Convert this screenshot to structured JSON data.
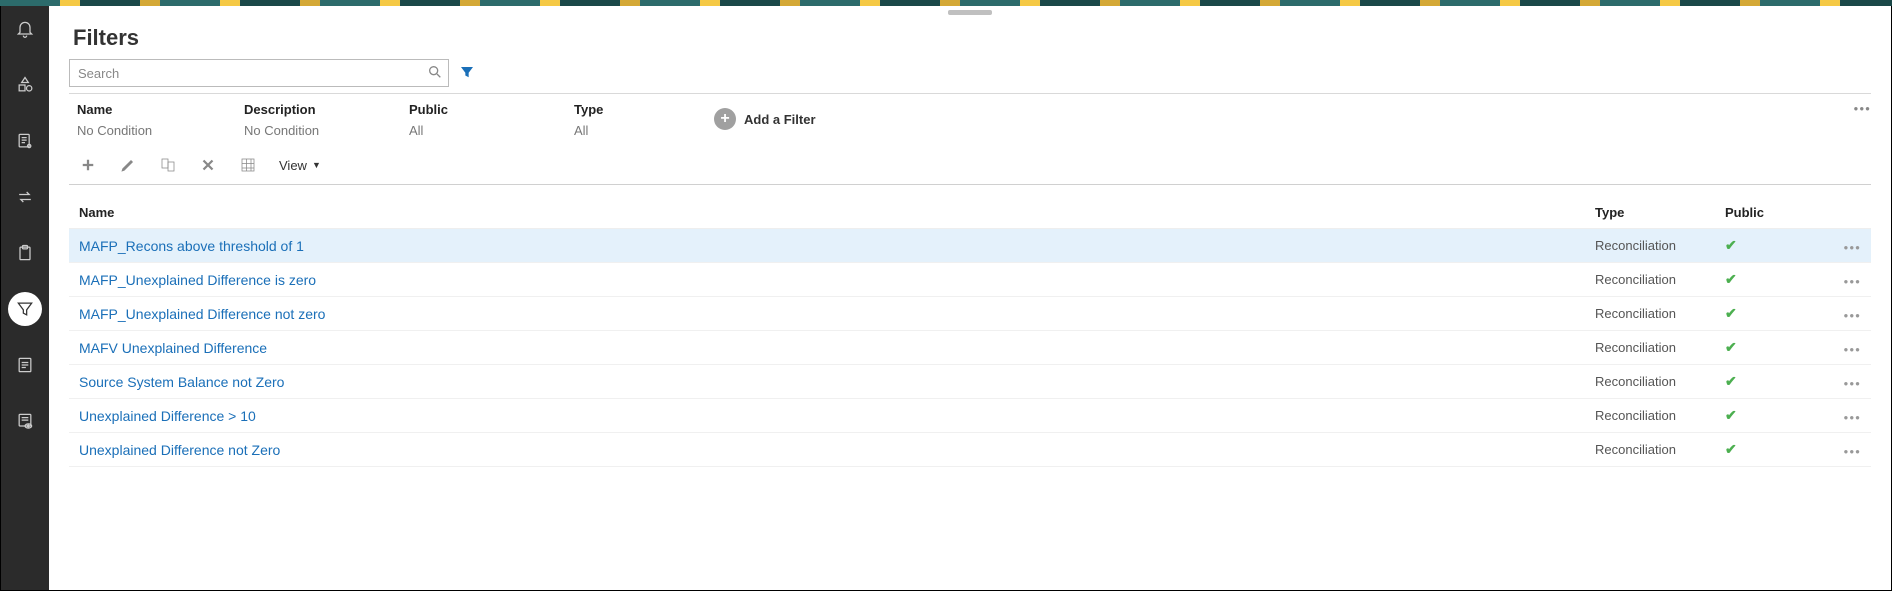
{
  "page": {
    "title": "Filters"
  },
  "search": {
    "placeholder": "Search"
  },
  "filterHeader": {
    "cols": {
      "name": {
        "label": "Name",
        "value": "No Condition"
      },
      "desc": {
        "label": "Description",
        "value": "No Condition"
      },
      "public": {
        "label": "Public",
        "value": "All"
      },
      "type": {
        "label": "Type",
        "value": "All"
      }
    },
    "add_label": "Add a Filter"
  },
  "toolbar": {
    "view_label": "View"
  },
  "table": {
    "headers": {
      "name": "Name",
      "type": "Type",
      "public": "Public"
    },
    "rows": [
      {
        "name": "MAFP_Recons above threshold of 1",
        "type": "Reconciliation",
        "public": true,
        "selected": true
      },
      {
        "name": "MAFP_Unexplained Difference is zero",
        "type": "Reconciliation",
        "public": true,
        "selected": false
      },
      {
        "name": "MAFP_Unexplained Difference not zero",
        "type": "Reconciliation",
        "public": true,
        "selected": false
      },
      {
        "name": "MAFV Unexplained Difference",
        "type": "Reconciliation",
        "public": true,
        "selected": false
      },
      {
        "name": "Source System Balance not Zero",
        "type": "Reconciliation",
        "public": true,
        "selected": false
      },
      {
        "name": "Unexplained Difference > 10",
        "type": "Reconciliation",
        "public": true,
        "selected": false
      },
      {
        "name": "Unexplained Difference not Zero",
        "type": "Reconciliation",
        "public": true,
        "selected": false
      }
    ]
  }
}
